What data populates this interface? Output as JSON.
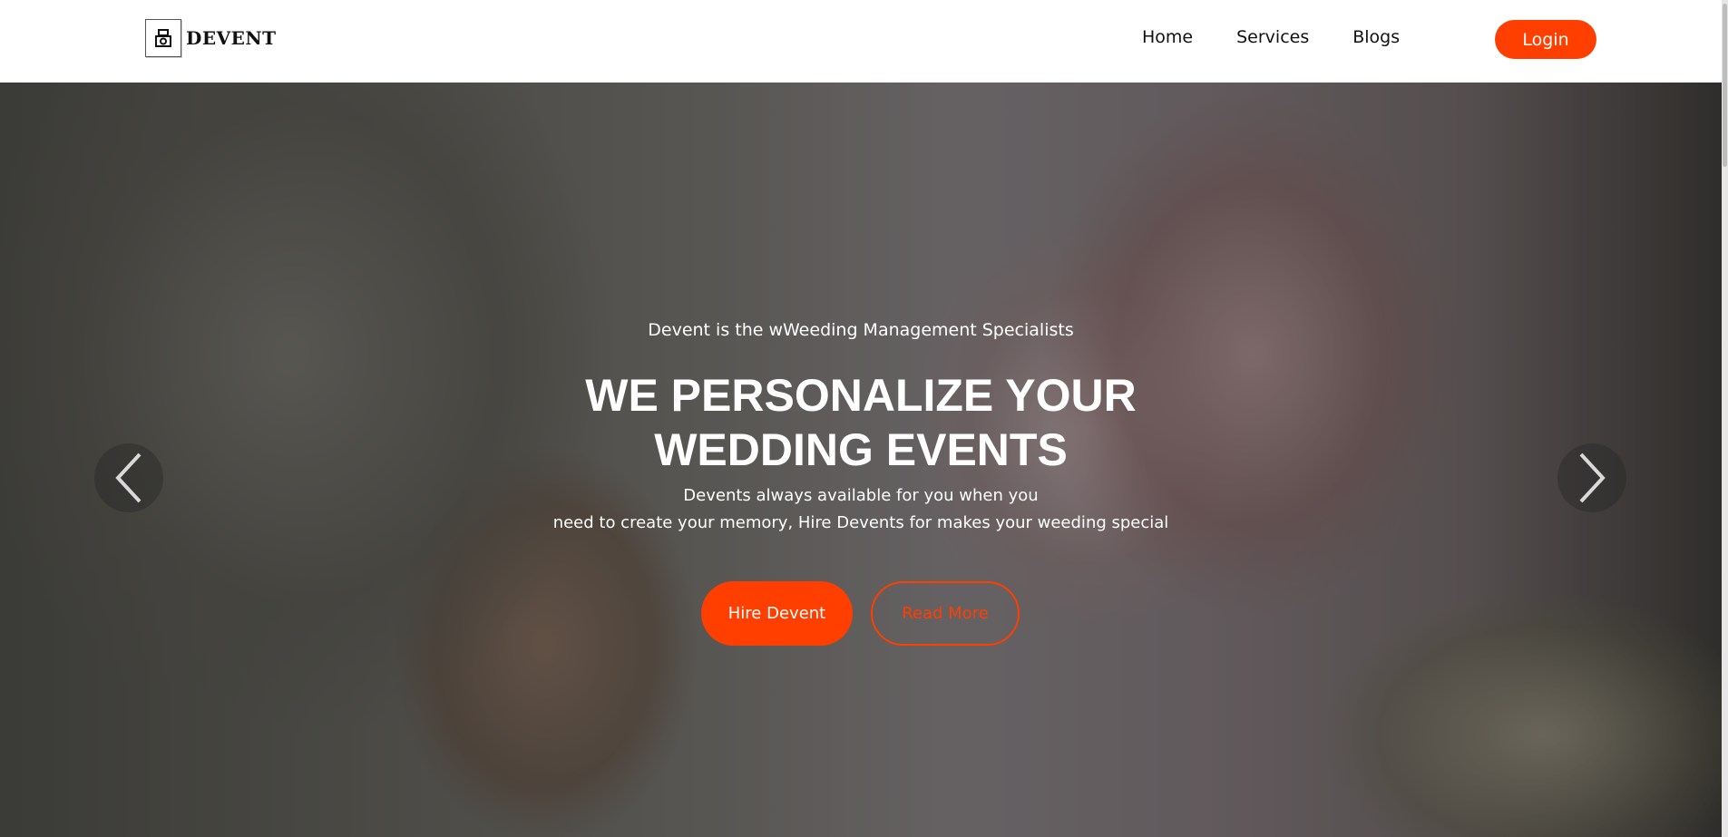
{
  "header": {
    "logo_text": "DEVENT",
    "logo_icon": "camera-icon",
    "nav": [
      {
        "label": "Home"
      },
      {
        "label": "Services"
      },
      {
        "label": "Blogs"
      }
    ],
    "login_label": "Login"
  },
  "hero": {
    "tagline": "Devent is the wWeeding Management Specialists",
    "headline_line1": "WE PERSONALIZE YOUR",
    "headline_line2": "WEDDING EVENTS",
    "description_line1": "Devents always available for you when you",
    "description_line2": "need to create your memory, Hire Devents for makes your weeding special",
    "hire_label": "Hire Devent",
    "read_more_label": "Read More",
    "prev_icon": "chevron-left-icon",
    "next_icon": "chevron-right-icon"
  },
  "colors": {
    "accent": "#ff3f00",
    "header_bg": "#ffffff",
    "text_dark": "#111111"
  }
}
